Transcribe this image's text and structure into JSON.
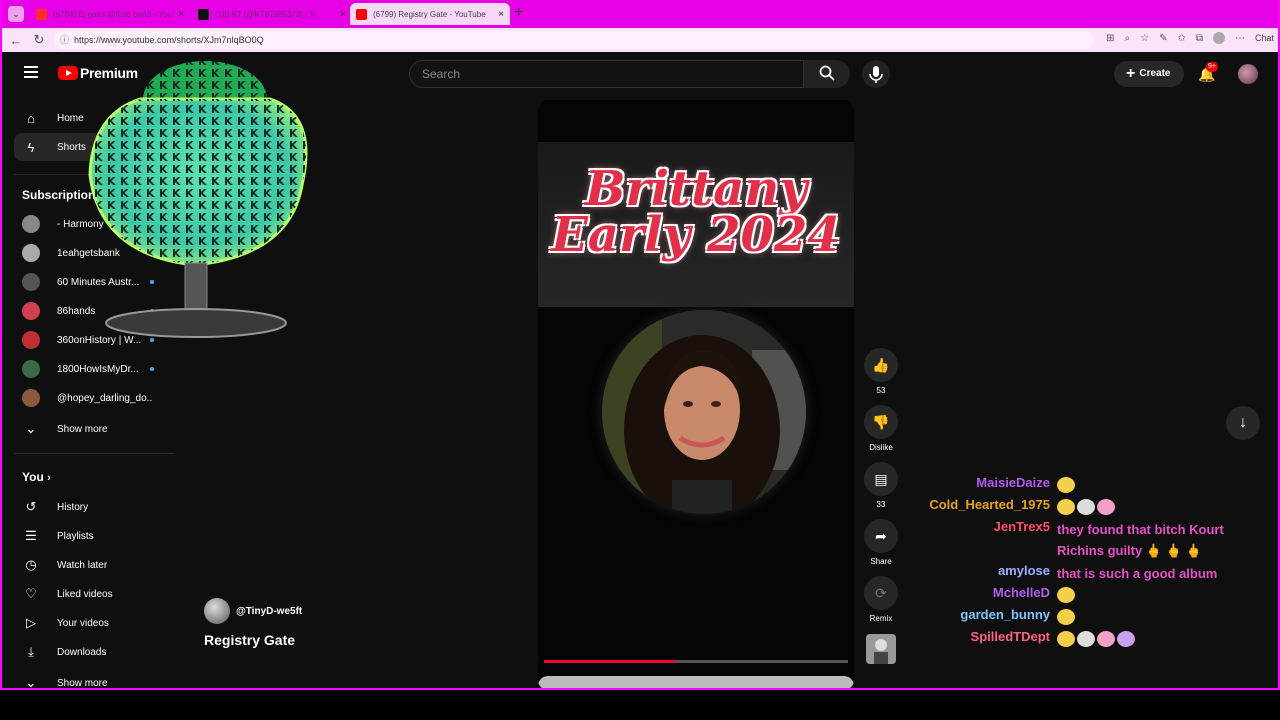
{
  "browser": {
    "tabs": [
      {
        "title": "(6784) Ej gaes @Kolc part3 - YouTube",
        "icon_color": "#ff2a2a",
        "active": false
      },
      {
        "title": "(18) KT (@KT87985373) / X",
        "icon_color": "#111111",
        "active": false
      },
      {
        "title": "(6799) Registry Gate - YouTube",
        "icon_color": "#ff0000",
        "active": true
      }
    ],
    "url": "https://www.youtube.com/shorts/XJm7nlqBO0Q",
    "chat_label": "Chat"
  },
  "header": {
    "logo_text": "Premium",
    "search_placeholder": "Search",
    "create_label": "Create",
    "notif_badge": "9+"
  },
  "sidebar": {
    "main": [
      {
        "label": "Home",
        "icon": "home-icon",
        "glyph": "⌂"
      },
      {
        "label": "Shorts",
        "icon": "shorts-icon",
        "glyph": "ϟ",
        "active": true
      }
    ],
    "subscriptions_title": "Subscriptions",
    "subscriptions": [
      {
        "label": "- Harmony",
        "color": "#888888",
        "dot": false
      },
      {
        "label": "1eahgetsbank",
        "color": "#aaaaaa",
        "dot": false
      },
      {
        "label": "60 Minutes Austr...",
        "color": "#555555",
        "dot": true
      },
      {
        "label": "86hands",
        "color": "#d04050",
        "dot": true
      },
      {
        "label": "360onHistory | W...",
        "color": "#c03030",
        "dot": true
      },
      {
        "label": "1800HowIsMyDr...",
        "color": "#3a6a4a",
        "dot": true
      },
      {
        "label": "@hopey_darling_do...",
        "color": "#8a5a3a",
        "dot": false
      }
    ],
    "show_more": "Show more",
    "you_title": "You",
    "you_items": [
      {
        "label": "History",
        "icon": "history-icon",
        "glyph": "↺"
      },
      {
        "label": "Playlists",
        "icon": "playlists-icon",
        "glyph": "☰"
      },
      {
        "label": "Watch later",
        "icon": "watch-later-icon",
        "glyph": "◷"
      },
      {
        "label": "Liked videos",
        "icon": "like-icon",
        "glyph": "♡"
      },
      {
        "label": "Your videos",
        "icon": "your-videos-icon",
        "glyph": "▷"
      },
      {
        "label": "Downloads",
        "icon": "download-icon",
        "glyph": "⤓"
      }
    ],
    "show_more_2": "Show more"
  },
  "short": {
    "overlay_title_line1": "Brittany",
    "overlay_title_line2": "Early 2024",
    "channel_handle": "@TinyD-we5ft",
    "video_title": "Registry Gate",
    "progress": 0.43
  },
  "actions": [
    {
      "name": "like",
      "glyph": "👍",
      "label": "53"
    },
    {
      "name": "dislike",
      "glyph": "👎",
      "label": "Dislike"
    },
    {
      "name": "comments",
      "glyph": "▤",
      "label": "33"
    },
    {
      "name": "share",
      "glyph": "➦",
      "label": "Share"
    },
    {
      "name": "remix",
      "glyph": "⟳",
      "label": "Remix"
    }
  ],
  "chat": [
    {
      "user": "MaisieDaize",
      "color": "#b05cf0",
      "text": "",
      "emotes": 1
    },
    {
      "user": "Cold_Hearted_1975",
      "color": "#e8a318",
      "text": "",
      "emotes": 3
    },
    {
      "user": "JenTrex5",
      "color": "#ff4d6a",
      "text": "they found that bitch Kourt Richins guilty 🖕 🖕 🖕",
      "emotes": 0
    },
    {
      "user": "amylose",
      "color": "#9ab0ff",
      "text": "that is such a good album",
      "emotes": 0
    },
    {
      "user": "MchelleD",
      "color": "#b05cf0",
      "text": "",
      "emotes": 1
    },
    {
      "user": "garden_bunny",
      "color": "#7cc6ff",
      "text": "",
      "emotes": 1
    },
    {
      "user": "SpilledTDept",
      "color": "#ff6080",
      "text": "",
      "emotes": 4
    }
  ]
}
